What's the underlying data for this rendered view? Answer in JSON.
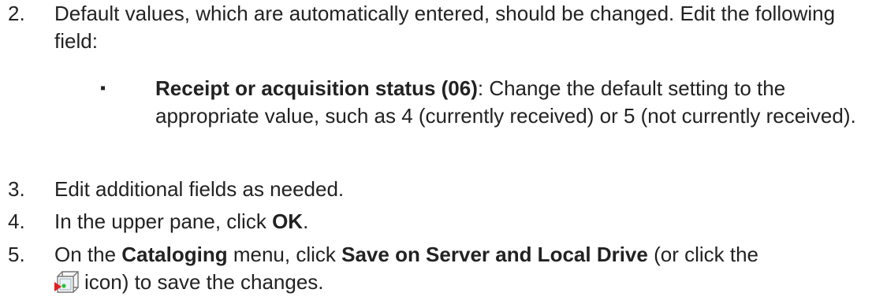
{
  "steps": [
    {
      "number": "2.",
      "text": "Default values, which are automatically entered, should be changed. Edit the following field:",
      "bullet": {
        "marker": "▪",
        "bold": "Receipt or acquisition status (06)",
        "rest": ": Change the default setting to the appropriate value, such as 4 (currently received) or 5 (not currently received)."
      }
    },
    {
      "number": "3.",
      "text": "Edit additional fields as needed."
    },
    {
      "number": "4.",
      "text_before": "In the upper pane, click ",
      "bold": "OK",
      "text_after": "."
    },
    {
      "number": "5.",
      "part1": "On the ",
      "bold1": "Cataloging",
      "part2": " menu, click ",
      "bold2": "Save on Server and Local Drive",
      "part3": " (or click the",
      "icon_name": "save-on-server-and-local-drive-icon",
      "part4": "icon) to save the changes."
    }
  ]
}
